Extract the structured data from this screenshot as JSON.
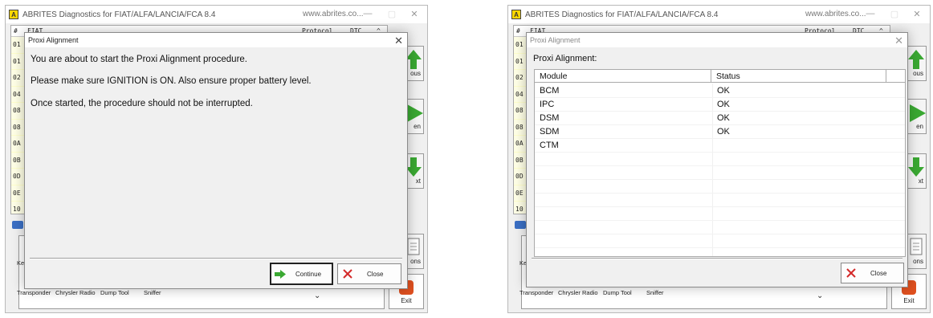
{
  "app": {
    "title": "ABRITES Diagnostics for FIAT/ALFA/LANCIA/FCA 8.4",
    "url": "www.abrites.co...",
    "logo_letter": "A",
    "min_label": "—",
    "max_label": "▢",
    "close_label": "✕"
  },
  "bg_list": {
    "header_num": "#",
    "header_name": "FIAT",
    "header_protocol": "Protocol",
    "header_dtc": "DTC",
    "header_sort": "^",
    "rows": [
      "01",
      "01",
      "02",
      "04",
      "08",
      "08",
      "0A",
      "0B",
      "0D",
      "0E",
      "10"
    ]
  },
  "side_buttons": {
    "previous": "ous",
    "open": "en",
    "next": "xt",
    "options": "ons",
    "exit": "Exit"
  },
  "bottom": {
    "key_label": "Key",
    "tools": [
      "Transponder",
      "Chrysler Radio",
      "Dump Tool",
      "Sniffer"
    ],
    "dropdown_chevron": "⌄"
  },
  "dialog_left": {
    "title": "Proxi Alignment",
    "close_glyph": "✕",
    "line1": "You are about to start the Proxi Alignment procedure.",
    "line2": "Please make sure IGNITION is ON. Also ensure proper battery level.",
    "line3": "Once started, the procedure should not be interrupted.",
    "continue_label": "Continue",
    "close_label": "Close",
    "continue_icon": "green-arrow-icon",
    "close_icon": "red-x-icon"
  },
  "dialog_right": {
    "title": "Proxi Alignment",
    "close_glyph": "✕",
    "heading": "Proxi Alignment:",
    "columns": [
      "Module",
      "Status"
    ],
    "rows": [
      {
        "module": "BCM",
        "status": "OK"
      },
      {
        "module": "IPC",
        "status": "OK"
      },
      {
        "module": "DSM",
        "status": "OK"
      },
      {
        "module": "SDM",
        "status": "OK"
      },
      {
        "module": "CTM",
        "status": ""
      }
    ],
    "close_label": "Close",
    "close_icon": "red-x-icon"
  },
  "colors": {
    "accent_green": "#3aa832",
    "close_red": "#d42a2a",
    "list_bg": "#ffffe6",
    "exit_orange": "#e0501f"
  }
}
